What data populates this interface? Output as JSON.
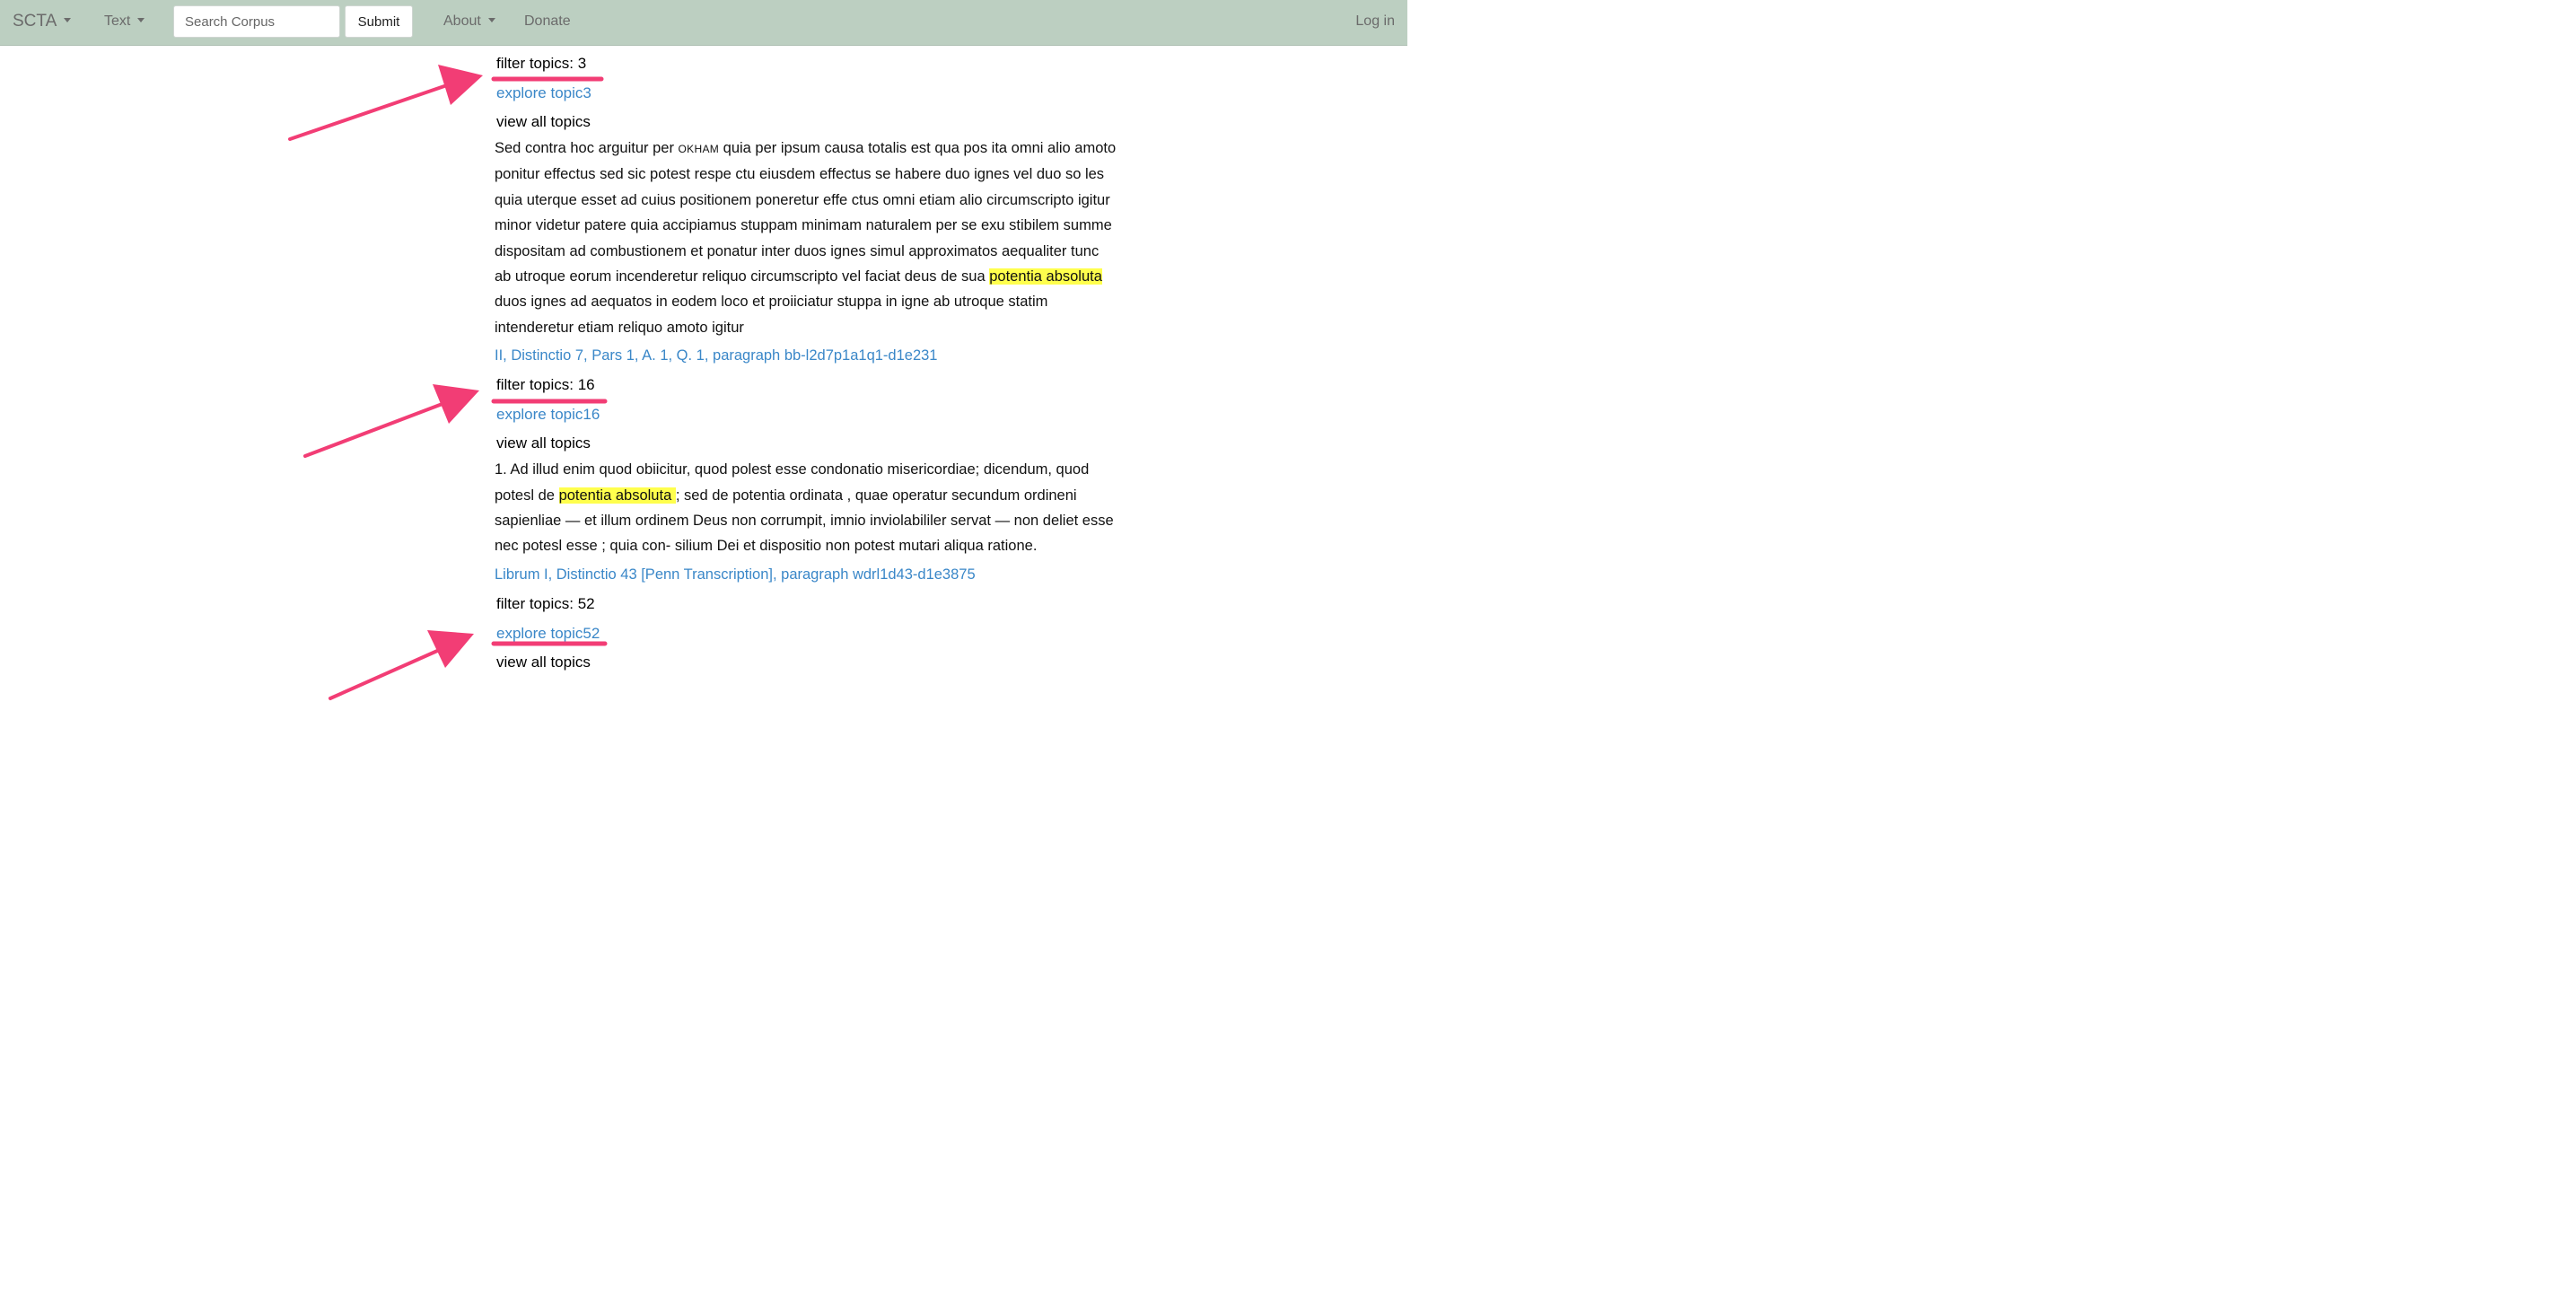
{
  "nav": {
    "brand": "SCTA",
    "text_menu": "Text",
    "search_placeholder": "Search Corpus",
    "submit_label": "Submit",
    "about_menu": "About",
    "donate": "Donate",
    "login": "Log in"
  },
  "results": [
    {
      "filter_label": "filter topics: 3",
      "explore_label": "explore topic3",
      "view_all_label": "view all topics",
      "text_before": "Sed contra hoc arguitur per ",
      "smallcaps": "OKHAM",
      "text_mid": " quia per ipsum causa totalis est qua pos ita omni alio amoto ponitur effectus sed sic potest respe ctu eiusdem effectus se habere duo ignes vel duo so les quia uterque esset ad cuius positionem poneretur effe ctus omni etiam alio circumscripto igitur minor videtur patere quia accipiamus stuppam minimam naturalem per se exu stibilem summe dispositam ad combustionem et ponatur inter duos ignes simul approximatos aequaliter tunc ab utroque eorum incenderetur reliquo circumscripto vel faciat deus de sua ",
      "highlight": "potentia absoluta ",
      "text_after": "duos ignes ad aequatos in eodem loco et proiiciatur stuppa in igne ab utroque statim intenderetur etiam reliquo amoto igitur",
      "citation": "II, Distinctio 7, Pars 1, A. 1, Q. 1, paragraph bb-l2d7p1a1q1-d1e231"
    },
    {
      "filter_label": "filter topics: 16",
      "explore_label": "explore topic16",
      "view_all_label": "view all topics",
      "text_before": "1. Ad illud enim quod obiicitur, quod polest esse condonatio misericordiae; dicendum, quod potesl de ",
      "highlight": "potentia absoluta ",
      "text_after": "; sed de potentia ordinata , quae operatur secundum ordineni sapienliae — et illum ordinem Deus non corrumpit, imnio inviolabililer servat — non deliet esse nec potesl esse ; quia con- silium Dei et dispositio non potest mutari aliqua ratione.",
      "citation": "Librum I, Distinctio 43 [Penn Transcription], paragraph wdrl1d43-d1e3875"
    },
    {
      "filter_label": "filter topics: 52",
      "explore_label": "explore topic52",
      "view_all_label": "view all topics"
    }
  ],
  "colors": {
    "navbar": "#bccfc1",
    "link": "#3a87c8",
    "highlight": "#ffff4d",
    "annotation": "#f23d75"
  }
}
